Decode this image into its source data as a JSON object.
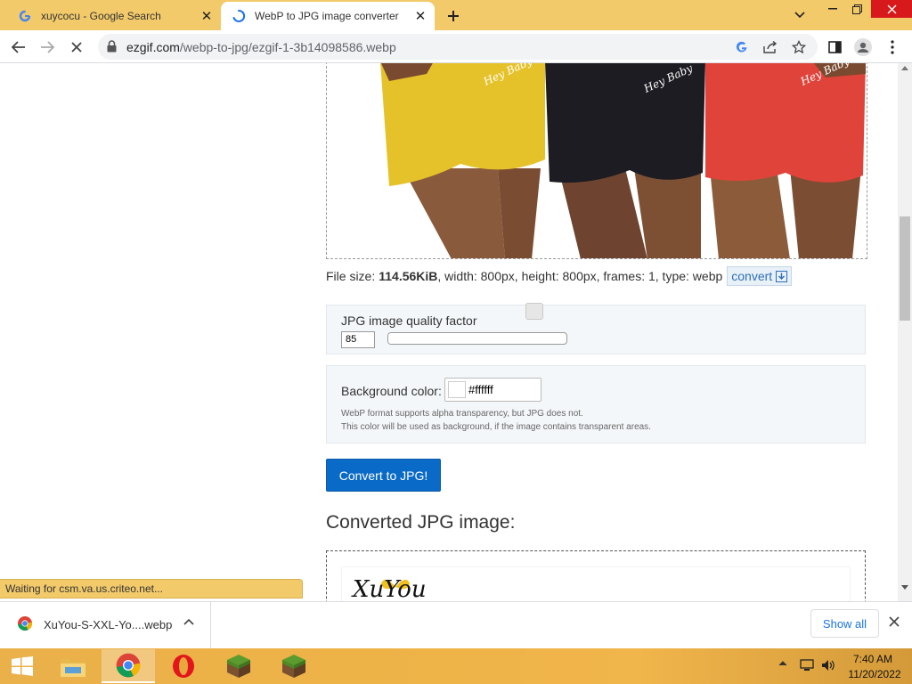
{
  "browser": {
    "tabs": [
      {
        "title": "xuycocu - Google Search",
        "favicon": "google-g-icon",
        "active": false
      },
      {
        "title": "WebP to JPG image converter",
        "favicon": "loading-spinner-icon",
        "active": true
      }
    ],
    "omnibox": {
      "domain": "ezgif.com",
      "path": "/webp-to-jpg/ezgif-1-3b14098586.webp"
    },
    "accent_color": "#f3ca6a"
  },
  "page": {
    "file_info": {
      "prefix": "File size:",
      "size": "114.56KiB",
      "rest": ", width: 800px, height: 800px, frames: 1, type: webp",
      "convert_label": "convert"
    },
    "quality": {
      "label": "JPG image quality factor",
      "value": "85",
      "slider_fraction": 0.85
    },
    "background": {
      "label": "Background color:",
      "value": "#ffffff",
      "note1": "WebP format supports alpha transparency, but JPG does not.",
      "note2": "This color will be used as background, if the image contains transparent areas."
    },
    "convert_button": "Convert to JPG!",
    "converted_heading": "Converted JPG image:",
    "brand_text": "XuYou",
    "image_text": [
      "Hey Baby",
      "Hey Baby",
      "Hey Baby"
    ],
    "primary_color": "#0a6ac7"
  },
  "status_bubble": "Waiting for csm.va.us.criteo.net...",
  "download_bar": {
    "file": "XuYou-S-XXL-Yo....webp",
    "show_all": "Show all"
  },
  "taskbar": {
    "apps": [
      "start-icon",
      "file-explorer-icon",
      "chrome-icon",
      "opera-icon",
      "minecraft-icon",
      "minecraft-icon"
    ],
    "time": "7:40 AM",
    "date": "11/20/2022"
  }
}
